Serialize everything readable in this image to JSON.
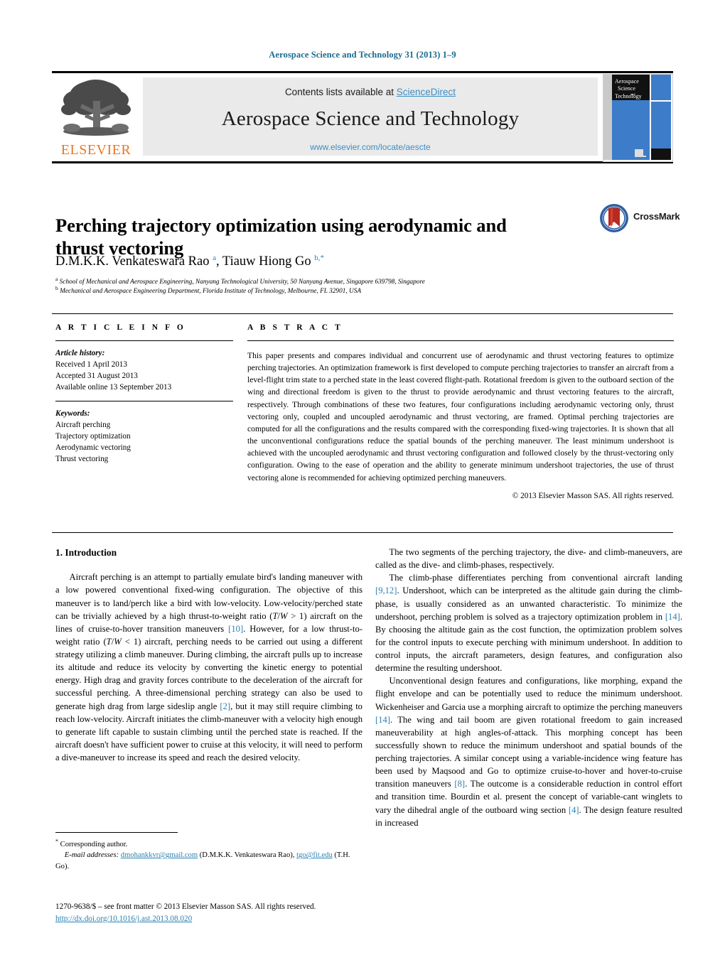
{
  "running_head": "Aerospace Science and Technology 31 (2013) 1–9",
  "masthead": {
    "contents_prefix": "Contents lists available at ",
    "sciencedirect": "ScienceDirect",
    "journal_name": "Aerospace Science and Technology",
    "journal_url": "www.elsevier.com/locate/aescte",
    "publisher_wordmark": "ELSEVIER",
    "publisher_color": "#e87722",
    "link_color": "#3a8fc4",
    "cover": {
      "line1": "Aerospace",
      "line2": "Science",
      "line3": "and",
      "line4": "Technology",
      "cover_blue": "#3d7cc9"
    }
  },
  "article": {
    "title": "Perching trajectory optimization using aerodynamic and thrust vectoring",
    "authors_html": "D.M.K.K. Venkateswara Rao <sup>a</sup>, Tiauw Hiong Go <sup>b,</sup><sup>*</sup>",
    "affiliation_a_marker": "a",
    "affiliation_a": "School of Mechanical and Aerospace Engineering, Nanyang Technological University, 50 Nanyang Avenue, Singapore 639798, Singapore",
    "affiliation_b_marker": "b",
    "affiliation_b": "Mechanical and Aerospace Engineering Department, Florida Institute of Technology, Melbourne, FL 32901, USA",
    "crossmark_label": "CrossMark"
  },
  "info": {
    "heading": "A R T I C L E    I N F O",
    "history_label": "Article history:",
    "history": [
      "Received 1 April 2013",
      "Accepted 31 August 2013",
      "Available online 13 September 2013"
    ],
    "keywords_label": "Keywords:",
    "keywords": [
      "Aircraft perching",
      "Trajectory optimization",
      "Aerodynamic vectoring",
      "Thrust vectoring"
    ]
  },
  "abstract": {
    "heading": "A B S T R A C T",
    "text": "This paper presents and compares individual and concurrent use of aerodynamic and thrust vectoring features to optimize perching trajectories. An optimization framework is first developed to compute perching trajectories to transfer an aircraft from a level-flight trim state to a perched state in the least covered flight-path. Rotational freedom is given to the outboard section of the wing and directional freedom is given to the thrust to provide aerodynamic and thrust vectoring features to the aircraft, respectively. Through combinations of these two features, four configurations including aerodynamic vectoring only, thrust vectoring only, coupled and uncoupled aerodynamic and thrust vectoring, are framed. Optimal perching trajectories are computed for all the configurations and the results compared with the corresponding fixed-wing trajectories. It is shown that all the unconventional configurations reduce the spatial bounds of the perching maneuver. The least minimum undershoot is achieved with the uncoupled aerodynamic and thrust vectoring configuration and followed closely by the thrust-vectoring only configuration. Owing to the ease of operation and the ability to generate minimum undershoot trajectories, the use of thrust vectoring alone is recommended for achieving optimized perching maneuvers.",
    "copyright": "© 2013 Elsevier Masson SAS. All rights reserved."
  },
  "body": {
    "section_heading": "1. Introduction",
    "left_paragraph_1_html": "Aircraft perching is an attempt to partially emulate bird's landing maneuver with a low powered conventional fixed-wing configuration. The objective of this maneuver is to land/perch like a bird with low-velocity. Low-velocity/perched state can be trivially achieved by a high thrust-to-weight ratio (<span class=\"mathit\">T</span>/<span class=\"mathit\">W</span> &gt; 1) aircraft on the lines of cruise-to-hover transition maneuvers <span class=\"cite\">[10]</span>. However, for a low thrust-to-weight ratio (<span class=\"mathit\">T</span>/<span class=\"mathit\">W</span> &lt; 1) aircraft, perching needs to be carried out using a different strategy utilizing a climb maneuver. During climbing, the aircraft pulls up to increase its altitude and reduce its velocity by converting the kinetic energy to potential energy. High drag and gravity forces contribute to the deceleration of the aircraft for successful perching. A three-dimensional perching strategy can also be used to generate high drag from large sideslip angle <span class=\"cite\">[2]</span>, but it may still require climbing to reach low-velocity. Aircraft initiates the climb-maneuver with a velocity high enough to generate lift capable to sustain climbing until the perched state is reached. If the aircraft doesn't have sufficient power to cruise at this velocity, it will need to perform a dive-maneuver to increase its speed and reach the desired velocity.",
    "right_paragraph_1_html": "The two segments of the perching trajectory, the dive- and climb-maneuvers, are called as the dive- and climb-phases, respectively.",
    "right_paragraph_2_html": "The climb-phase differentiates perching from conventional aircraft landing <span class=\"cite\">[9,12]</span>. Undershoot, which can be interpreted as the altitude gain during the climb-phase, is usually considered as an unwanted characteristic. To minimize the undershoot, perching problem is solved as a trajectory optimization problem in <span class=\"cite\">[14]</span>. By choosing the altitude gain as the cost function, the optimization problem solves for the control inputs to execute perching with minimum undershoot. In addition to control inputs, the aircraft parameters, design features, and configuration also determine the resulting undershoot.",
    "right_paragraph_3_html": "Unconventional design features and configurations, like morphing, expand the flight envelope and can be potentially used to reduce the minimum undershoot. Wickenheiser and Garcia use a morphing aircraft to optimize the perching maneuvers <span class=\"cite\">[14]</span>. The wing and tail boom are given rotational freedom to gain increased maneuverability at high angles-of-attack. This morphing concept has been successfully shown to reduce the minimum undershoot and spatial bounds of the perching trajectories. A similar concept using a variable-incidence wing feature has been used by Maqsood and Go to optimize cruise-to-hover and hover-to-cruise transition maneuvers <span class=\"cite\">[8]</span>. The outcome is a considerable reduction in control effort and transition time. Bourdin et al. present the concept of variable-cant winglets to vary the dihedral angle of the outboard wing section <span class=\"cite\">[4]</span>. The design feature resulted in increased"
  },
  "footnote": {
    "star": "*",
    "corresponding": "Corresponding author.",
    "email_label": "E-mail addresses:",
    "email_1": "dmohankkvr@gmail.com",
    "email_1_owner": "(D.M.K.K. Venkateswara Rao),",
    "email_2": "tgo@fit.edu",
    "email_2_owner": "(T.H. Go).",
    "imprint": "1270-9638/$ – see front matter © 2013 Elsevier Masson SAS. All rights reserved.",
    "doi": "http://dx.doi.org/10.1016/j.ast.2013.08.020"
  }
}
